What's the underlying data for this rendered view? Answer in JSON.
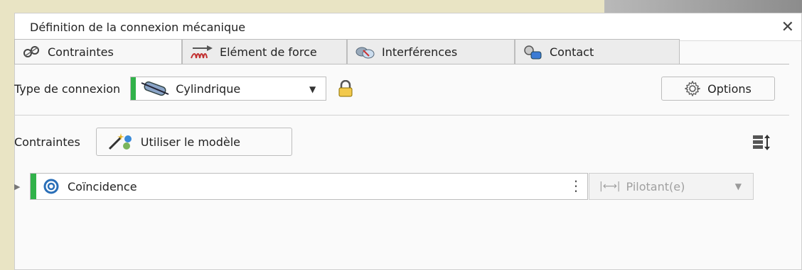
{
  "dialog": {
    "title": "Définition de la connexion mécanique",
    "close_glyph": "✕"
  },
  "tabs": [
    {
      "label": "Contraintes",
      "icon": "constraints-icon",
      "active": true
    },
    {
      "label": "Elément de force",
      "icon": "spring-force-icon",
      "active": false
    },
    {
      "label": "Interférences",
      "icon": "interference-icon",
      "active": false
    },
    {
      "label": "Contact",
      "icon": "contact-icon",
      "active": false
    }
  ],
  "connection": {
    "label": "Type de connexion",
    "type_value": "Cylindrique",
    "type_icon": "cylinder-icon",
    "lock_icon": "lock-icon",
    "options_label": "Options"
  },
  "constraints": {
    "label": "Contraintes",
    "use_model_label": "Utiliser le modèle",
    "items": [
      {
        "name": "Coïncidence",
        "mode": "Pilotant(e)"
      }
    ]
  },
  "colors": {
    "accent_green": "#31b24a",
    "tab_active": "#f7f7f7"
  }
}
